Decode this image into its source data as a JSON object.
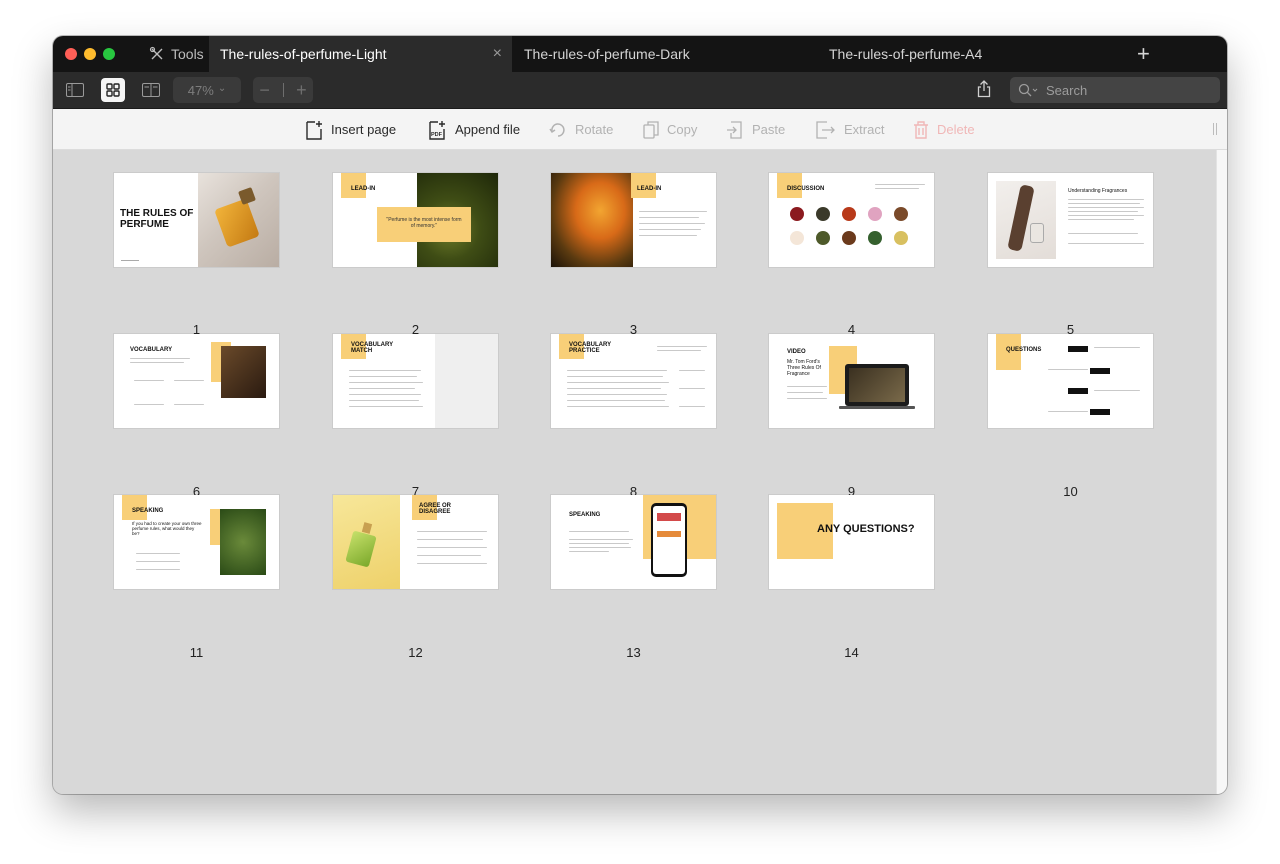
{
  "tabbar": {
    "tools_label": "Tools",
    "tabs": [
      {
        "label": "The-rules-of-perfume-Light",
        "close": "×"
      },
      {
        "label": "The-rules-of-perfume-Dark"
      },
      {
        "label": "The-rules-of-perfume-A4"
      }
    ],
    "add_tab": "+"
  },
  "toolbar": {
    "zoom_value": "47%",
    "zoom_chevron": "⌄",
    "zoom_minus": "−",
    "zoom_plus": "+",
    "search_placeholder": "Search"
  },
  "actions": [
    {
      "label": "Insert page",
      "icon": "insert-page-icon",
      "enabled": true
    },
    {
      "label": "Append file",
      "icon": "append-pdf-icon",
      "enabled": true
    },
    {
      "label": "Rotate",
      "icon": "rotate-icon",
      "enabled": false
    },
    {
      "label": "Copy",
      "icon": "copy-icon",
      "enabled": false
    },
    {
      "label": "Paste",
      "icon": "paste-icon",
      "enabled": false
    },
    {
      "label": "Extract",
      "icon": "extract-icon",
      "enabled": false
    },
    {
      "label": "Delete",
      "icon": "trash-icon",
      "enabled": false
    }
  ],
  "pages": [
    {
      "num": "1",
      "title": "THE RULES OF PERFUME"
    },
    {
      "num": "2",
      "title": "LEAD-IN",
      "quote": "\"Perfume is the most intense form of memory.\""
    },
    {
      "num": "3",
      "title": "LEAD-IN"
    },
    {
      "num": "4",
      "title": "DISCUSSION"
    },
    {
      "num": "5",
      "title": "Understanding Fragrances"
    },
    {
      "num": "6",
      "title": "VOCABULARY"
    },
    {
      "num": "7",
      "title": "VOCABULARY MATCH"
    },
    {
      "num": "8",
      "title": "VOCABULARY PRACTICE"
    },
    {
      "num": "9",
      "title": "VIDEO",
      "subtitle": "Mr. Tom Ford's Three Rules Of Fragrance"
    },
    {
      "num": "10",
      "title": "QUESTIONS"
    },
    {
      "num": "11",
      "title": "SPEAKING",
      "subtitle": "If you had to create your own three perfume rules, what would they be?"
    },
    {
      "num": "12",
      "title": "AGREE OR DISAGREE"
    },
    {
      "num": "13",
      "title": "SPEAKING"
    },
    {
      "num": "14",
      "title": "ANY QUESTIONS?"
    }
  ],
  "colors": {
    "accent_yellow": "#f8cf78",
    "tab_active": "#2b2b2b",
    "tabbar_bg": "#141414"
  }
}
